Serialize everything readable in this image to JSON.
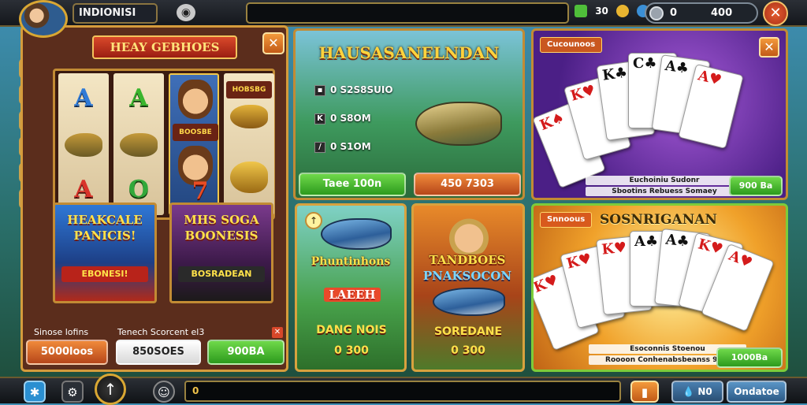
{
  "topbar": {
    "player_name": "INDIONISI",
    "gems_value": "30",
    "coins_left": "0",
    "coins_right": "400"
  },
  "slot": {
    "title": "HEAY GEBHOES",
    "reel_labels": [
      "BOOSBE",
      "HOBSBG"
    ],
    "promo_left_line1": "HEAKCALE",
    "promo_left_line2": "PANICIS!",
    "promo_left_sub": "EBONESI!",
    "promo_right_line1": "MHS SOGA",
    "promo_right_line2": "BOONESIS",
    "promo_right_sub": "BOSRADEAN",
    "label_left": "Sinose lofins",
    "label_mid": "Tenech Scorcent el3",
    "btn_left": "5000loos",
    "btn_mid": "850SOES",
    "btn_right": "900BA"
  },
  "fishing": {
    "title": "HAUSASANELNDAN",
    "rows": [
      "0 S2S8SUIO",
      "0 S8OM",
      "0 S1OM"
    ],
    "btn_left": "Taee 100n",
    "btn_right": "450 7303"
  },
  "cards_top": {
    "tab": "Cucounoos",
    "caption": "Euchoiniu Sudonr",
    "caption2": "Sbootins Rebuess Somaey",
    "button": "900 Ba"
  },
  "cards_bottom": {
    "tab": "Snnoous",
    "title": "SOSNRIGANAN",
    "caption": "Esoconnis Stoenou",
    "caption2": "Roooon Conhenabsbeanss 900i",
    "button": "1000Ba"
  },
  "tile_fish": {
    "title": "Phuntinhons",
    "sub": "LAEEH",
    "name": "DANG NOIS",
    "value": "0 300"
  },
  "tile_luck": {
    "title1": "TANDBOES",
    "title2": "PNAKSOCON",
    "name": "SOREDANE",
    "value": "0 300"
  },
  "bottombar": {
    "search_value": "0",
    "btn_right_a": "N0",
    "btn_right_b": "Ondatoe"
  }
}
